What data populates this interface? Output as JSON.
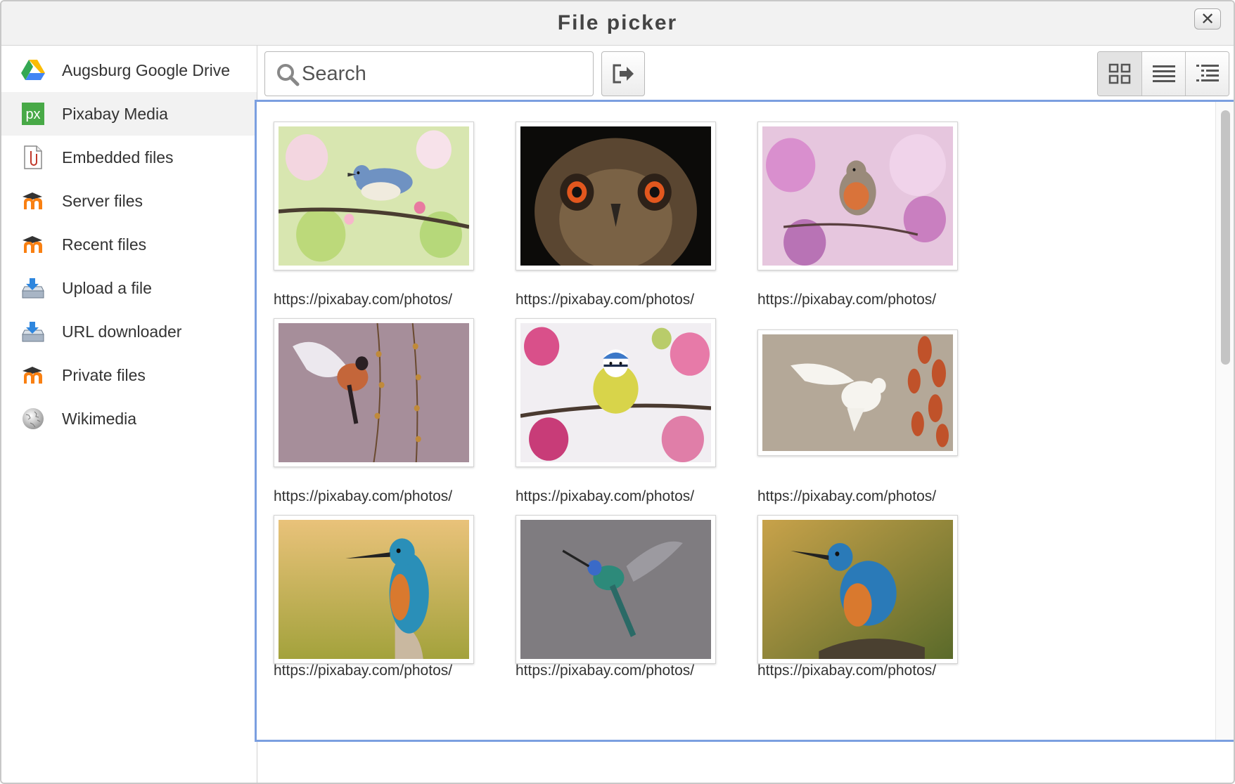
{
  "window": {
    "title": "File picker",
    "close_icon": "close-icon"
  },
  "sidebar": {
    "items": [
      {
        "label": "Augsburg Google Drive",
        "icon": "google-drive-icon",
        "active": false
      },
      {
        "label": "Pixabay Media",
        "icon": "pixabay-icon",
        "active": true
      },
      {
        "label": "Embedded files",
        "icon": "embedded-file-icon",
        "active": false
      },
      {
        "label": "Server files",
        "icon": "moodle-icon",
        "active": false
      },
      {
        "label": "Recent files",
        "icon": "moodle-icon",
        "active": false
      },
      {
        "label": "Upload a file",
        "icon": "upload-icon",
        "active": false
      },
      {
        "label": "URL downloader",
        "icon": "upload-icon",
        "active": false
      },
      {
        "label": "Private files",
        "icon": "moodle-icon",
        "active": false
      },
      {
        "label": "Wikimedia",
        "icon": "wikimedia-icon",
        "active": false
      }
    ]
  },
  "toolbar": {
    "search_placeholder": "Search",
    "logout_icon": "logout-icon",
    "view_modes": [
      "grid-view-icon",
      "list-view-icon",
      "tree-view-icon"
    ],
    "active_view": "grid-view-icon"
  },
  "files": [
    {
      "label": "https://pixabay.com/photos/",
      "subject": "nuthatch-icon"
    },
    {
      "label": "https://pixabay.com/photos/",
      "subject": "owl-icon"
    },
    {
      "label": "https://pixabay.com/photos/",
      "subject": "robin-icon"
    },
    {
      "label": "https://pixabay.com/photos/",
      "subject": "flying-bird-icon"
    },
    {
      "label": "https://pixabay.com/photos/",
      "subject": "blue-tit-icon"
    },
    {
      "label": "https://pixabay.com/photos/",
      "subject": "dove-icon"
    },
    {
      "label": "https://pixabay.com/photos/",
      "subject": "kingfisher-icon"
    },
    {
      "label": "https://pixabay.com/photos/",
      "subject": "hummingbird-icon"
    },
    {
      "label": "https://pixabay.com/photos/",
      "subject": "kingfisher-icon"
    }
  ],
  "colors": {
    "accent_border": "#7b9fe0",
    "sidebar_active": "#f2f2f2",
    "pixabay_green": "#48a947",
    "moodle_orange": "#f98012"
  }
}
